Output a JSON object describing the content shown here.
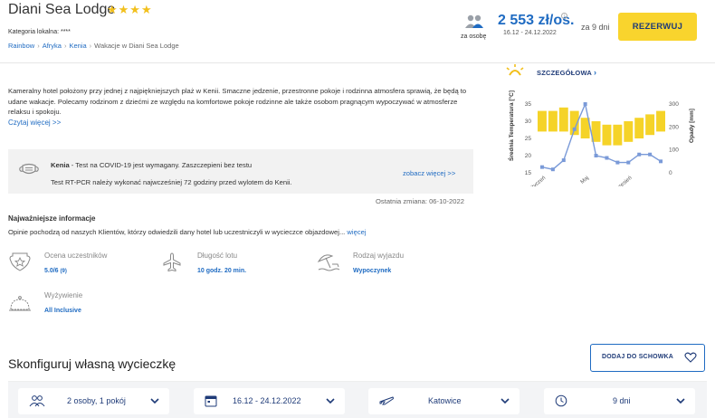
{
  "header": {
    "hotel_name": "Diani Sea Lodge",
    "stars": "★★★★",
    "category": "Kategoria lokalna: ****",
    "breadcrumbs": [
      "Rainbow",
      "Afryka",
      "Kenia",
      "Wakacje w Diani Sea Lodge"
    ],
    "per_person_label": "za osobę",
    "price": "2 553 zł/os.",
    "dates": "16.12 - 24.12.2022",
    "duration": "za 9 dni",
    "reserve_label": "REZERWUJ"
  },
  "description": {
    "text": "Kameralny hotel położony przy jednej z najpiękniejszych plaż w Kenii. Smaczne jedzenie, przestronne pokoje i rodzinna atmosfera sprawią, że będą to udane wakacje. Polecamy rodzinom z dziećmi ze względu na komfortowe pokoje rodzinne ale także osobom pragnącym wypoczywać w atmosferze relaksu i spokoju.",
    "read_more": "Czytaj więcej >>"
  },
  "covid": {
    "country": "Kenia",
    "line1_rest": " - Test na COVID-19 jest wymagany. Zaszczepieni bez testu",
    "line2": "Test RT-PCR należy wykonać najwcześniej 72 godziny przed wylotem do Kenii.",
    "see_more": "zobacz więcej >>",
    "last_change": "Ostatnia zmiana: 06-10-2022"
  },
  "key_info": {
    "heading": "Najważniejsze informacje",
    "desc": "Opinie pochodzą od naszych Klientów, którzy odwiedzili dany hotel lub uczestniczyli w wycieczce objazdowej...",
    "more": "więcej",
    "features": [
      {
        "label": "Ocena uczestników",
        "value": "5.0/6",
        "sub": "(9)",
        "icon": "star-badge-icon"
      },
      {
        "label": "Długość lotu",
        "value": "10 godz. 20 min.",
        "icon": "plane-icon"
      },
      {
        "label": "Rodzaj wyjazdu",
        "value": "Wypoczynek",
        "icon": "beach-umbrella-icon"
      },
      {
        "label": "Wyżywienie",
        "value": "All Inclusive",
        "icon": "food-cloche-icon"
      }
    ]
  },
  "climate": {
    "link": "SZCZEGÓŁOWA",
    "icon": "sun-icon"
  },
  "chart_data": {
    "type": "bar",
    "ylabel": "Średnia Temperatura [°C]",
    "y2label": "Opady [mm]",
    "ylim": [
      15,
      35
    ],
    "y2lim": [
      0,
      300
    ],
    "yticks": [
      15,
      20,
      25,
      30,
      35
    ],
    "y2ticks": [
      0,
      100,
      200,
      300
    ],
    "x_labels": [
      "Styczeń",
      "Maj",
      "Wrzesień"
    ],
    "series": [
      {
        "type": "floating-bar",
        "color": "#f5d328",
        "low": [
          27,
          27,
          27,
          26,
          25,
          24,
          23,
          23,
          24,
          25,
          26,
          27
        ],
        "high": [
          33,
          33,
          34,
          33,
          31,
          30,
          29,
          29,
          30,
          31,
          32,
          33
        ]
      },
      {
        "type": "line",
        "color": "#7a9ad8",
        "values": [
          25,
          15,
          55,
          190,
          300,
          75,
          65,
          45,
          45,
          80,
          80,
          50
        ]
      }
    ]
  },
  "configurator": {
    "title": "Skonfiguruj własną wycieczkę",
    "save_label": "DODAJ DO SCHOWKA",
    "selectors": [
      {
        "label": "2 osoby, 1 pokój",
        "icon": "people-icon"
      },
      {
        "label": "16.12 - 24.12.2022",
        "icon": "calendar-icon"
      },
      {
        "label": "Katowice",
        "icon": "plane-icon"
      },
      {
        "label": "9 dni",
        "icon": "clock-icon"
      }
    ]
  },
  "colors": {
    "brand_blue": "#1f6bc2",
    "accent_yellow": "#f9d42d",
    "navy": "#1f3b78"
  }
}
